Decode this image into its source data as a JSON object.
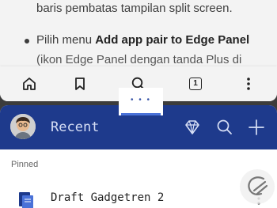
{
  "browser": {
    "article": {
      "line1": "baris pembatas tampilan split screen.",
      "line2_prefix": "Pilih menu ",
      "line2_bold": "Add app pair to Edge Panel",
      "line3": "(ikon Edge Panel dengan tanda Plus di"
    },
    "toolbar": {
      "tab_count": "1",
      "icons": [
        "home-icon",
        "bookmark-icon",
        "search-icon",
        "tabs-icon",
        "more-vertical-icon"
      ]
    }
  },
  "split_handle": {
    "dots": "• • •"
  },
  "app": {
    "header_title": "Recent",
    "header_color": "#1e3a8c",
    "header_icons": [
      "diamond-icon",
      "search-icon",
      "plus-icon"
    ],
    "section_label": "Pinned",
    "items": [
      {
        "title": "Draft Gadgetren 2"
      }
    ],
    "watermark_icon": "gadgetren-logo-icon"
  }
}
